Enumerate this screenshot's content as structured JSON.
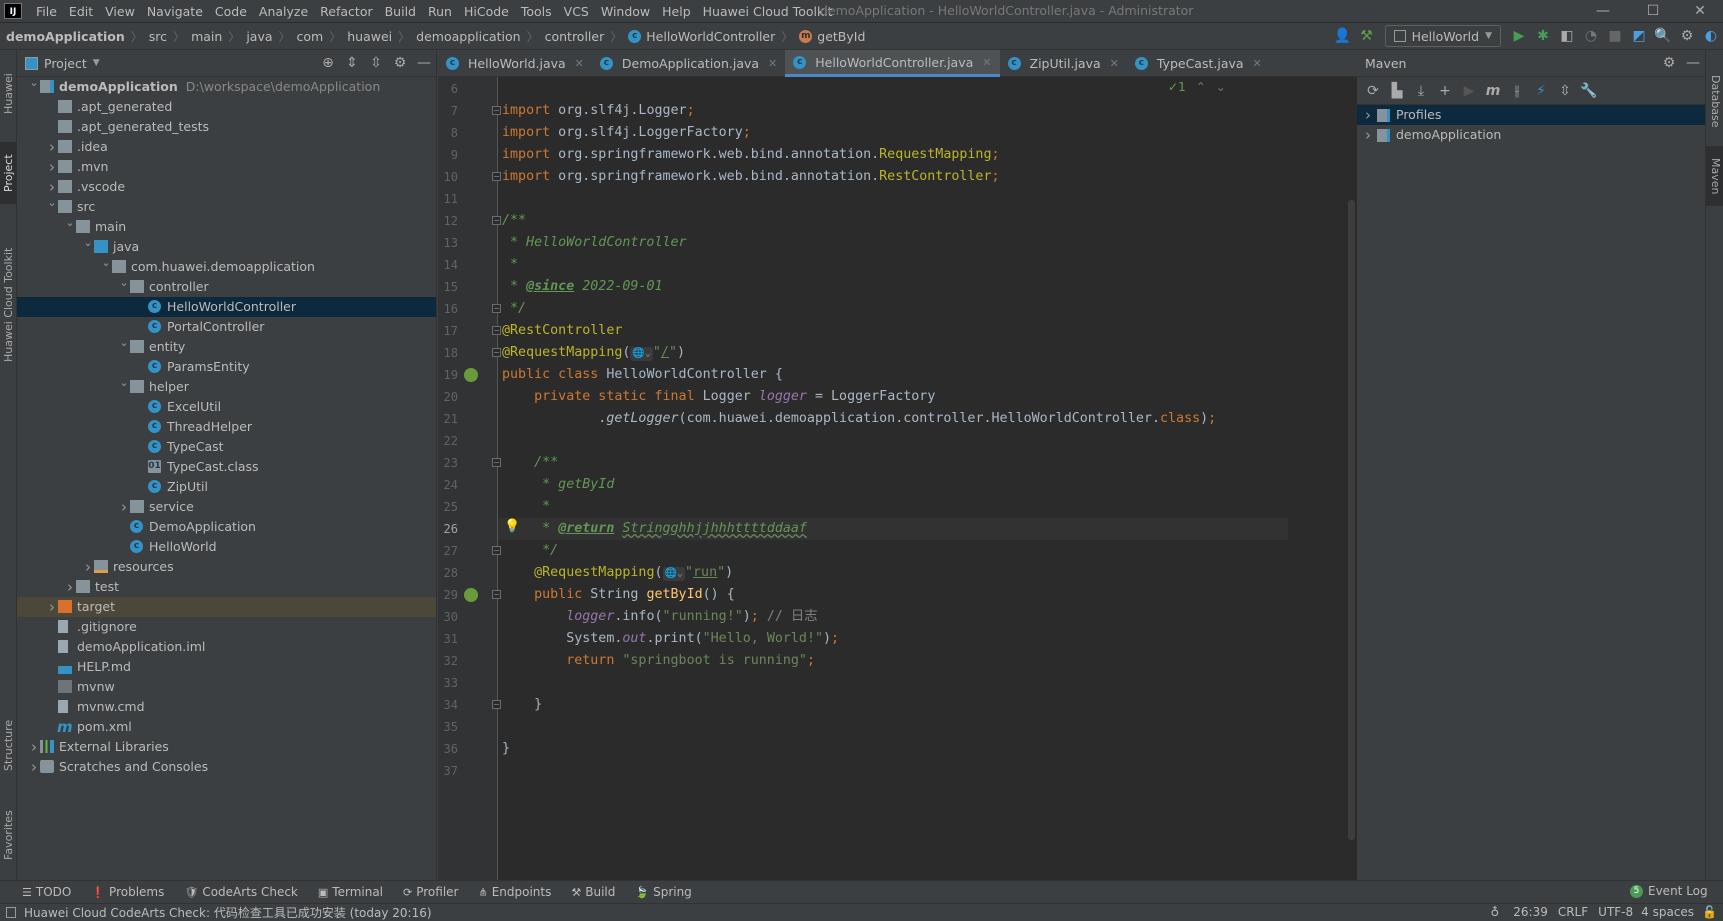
{
  "window": {
    "title": "demoApplication - HelloWorldController.java - Administrator",
    "app_logo": "IJ"
  },
  "menu": [
    "File",
    "Edit",
    "View",
    "Navigate",
    "Code",
    "Analyze",
    "Refactor",
    "Build",
    "Run",
    "HiCode",
    "Tools",
    "VCS",
    "Window",
    "Help",
    "Huawei Cloud Toolkit"
  ],
  "breadcrumb": [
    "demoApplication",
    "src",
    "main",
    "java",
    "com",
    "huawei",
    "demoapplication",
    "controller",
    "HelloWorldController",
    "getById"
  ],
  "toolbar": {
    "run_config": "HelloWorld"
  },
  "left_strip": [
    "Huawei Plugins",
    "Project",
    "Huawei Cloud Toolkit",
    "Structure",
    "Favorites"
  ],
  "right_strip": [
    "Database",
    "Maven"
  ],
  "project": {
    "title": "Project",
    "tree": [
      {
        "label": "demoApplication",
        "level": 0,
        "state": "open",
        "icon": "module",
        "bold": true,
        "extra": "D:\\workspace\\demoApplication"
      },
      {
        "label": ".apt_generated",
        "level": 1,
        "icon": "folder"
      },
      {
        "label": ".apt_generated_tests",
        "level": 1,
        "icon": "folder"
      },
      {
        "label": ".idea",
        "level": 1,
        "state": "closed",
        "icon": "folder"
      },
      {
        "label": ".mvn",
        "level": 1,
        "state": "closed",
        "icon": "folder"
      },
      {
        "label": ".vscode",
        "level": 1,
        "state": "closed",
        "icon": "folder"
      },
      {
        "label": "src",
        "level": 1,
        "state": "open",
        "icon": "folder"
      },
      {
        "label": "main",
        "level": 2,
        "state": "open",
        "icon": "folder"
      },
      {
        "label": "java",
        "level": 3,
        "state": "open",
        "icon": "source-folder"
      },
      {
        "label": "com.huawei.demoapplication",
        "level": 4,
        "state": "open",
        "icon": "package"
      },
      {
        "label": "controller",
        "level": 5,
        "state": "open",
        "icon": "package"
      },
      {
        "label": "HelloWorldController",
        "level": 6,
        "icon": "class",
        "selected": true
      },
      {
        "label": "PortalController",
        "level": 6,
        "icon": "class"
      },
      {
        "label": "entity",
        "level": 5,
        "state": "open",
        "icon": "package"
      },
      {
        "label": "ParamsEntity",
        "level": 6,
        "icon": "class"
      },
      {
        "label": "helper",
        "level": 5,
        "state": "open",
        "icon": "package"
      },
      {
        "label": "ExcelUtil",
        "level": 6,
        "icon": "class"
      },
      {
        "label": "ThreadHelper",
        "level": 6,
        "icon": "class"
      },
      {
        "label": "TypeCast",
        "level": 6,
        "icon": "class"
      },
      {
        "label": "TypeCast.class",
        "level": 6,
        "icon": "class-file"
      },
      {
        "label": "ZipUtil",
        "level": 6,
        "icon": "class"
      },
      {
        "label": "service",
        "level": 5,
        "state": "closed",
        "icon": "package"
      },
      {
        "label": "DemoApplication",
        "level": 5,
        "icon": "spring-class"
      },
      {
        "label": "HelloWorld",
        "level": 5,
        "icon": "runnable-class"
      },
      {
        "label": "resources",
        "level": 3,
        "state": "closed",
        "icon": "resources-folder"
      },
      {
        "label": "test",
        "level": 2,
        "state": "closed",
        "icon": "folder"
      },
      {
        "label": "target",
        "level": 1,
        "state": "closed",
        "icon": "excluded-folder",
        "highlighted": true
      },
      {
        "label": ".gitignore",
        "level": 1,
        "icon": "file"
      },
      {
        "label": "demoApplication.iml",
        "level": 1,
        "icon": "file"
      },
      {
        "label": "HELP.md",
        "level": 1,
        "icon": "markdown"
      },
      {
        "label": "mvnw",
        "level": 1,
        "icon": "shell"
      },
      {
        "label": "mvnw.cmd",
        "level": 1,
        "icon": "text-file"
      },
      {
        "label": "pom.xml",
        "level": 1,
        "icon": "maven"
      },
      {
        "label": "External Libraries",
        "level": 0,
        "state": "closed",
        "icon": "libraries"
      },
      {
        "label": "Scratches and Consoles",
        "level": 0,
        "state": "closed",
        "icon": "scratches"
      }
    ]
  },
  "editor": {
    "tabs": [
      {
        "label": "HelloWorld.java"
      },
      {
        "label": "DemoApplication.java"
      },
      {
        "label": "HelloWorldController.java",
        "active": true
      },
      {
        "label": "ZipUtil.java"
      },
      {
        "label": "TypeCast.java"
      }
    ],
    "inspection_count": "1",
    "current_line": 26,
    "first_line": 6,
    "fold_lines": [
      7,
      10,
      12,
      16,
      17,
      18,
      23,
      27,
      29,
      34
    ],
    "spring_gutter_lines": [
      19,
      29
    ],
    "bulb_line": 26,
    "lines": [
      [],
      [
        [
          "kw",
          "import "
        ],
        [
          "t",
          "org.slf4j.Logger"
        ],
        [
          "semi",
          ";"
        ]
      ],
      [
        [
          "kw",
          "import "
        ],
        [
          "t",
          "org.slf4j.LoggerFactory"
        ],
        [
          "semi",
          ";"
        ]
      ],
      [
        [
          "kw",
          "import "
        ],
        [
          "t",
          "org.springframework.web.bind.annotation."
        ],
        [
          "ann",
          "RequestMapping"
        ],
        [
          "semi",
          ";"
        ]
      ],
      [
        [
          "kw",
          "import "
        ],
        [
          "t",
          "org.springframework.web.bind.annotation."
        ],
        [
          "ann",
          "RestController"
        ],
        [
          "semi",
          ";"
        ]
      ],
      [],
      [
        [
          "doc",
          "/**"
        ]
      ],
      [
        [
          "doc",
          " * HelloWorldController"
        ]
      ],
      [
        [
          "doc",
          " *"
        ]
      ],
      [
        [
          "doc",
          " * "
        ],
        [
          "dtag",
          "@since"
        ],
        [
          "doc",
          " 2022-09-01"
        ]
      ],
      [
        [
          "doc",
          " */"
        ]
      ],
      [
        [
          "ann",
          "@RestController"
        ]
      ],
      [
        [
          "ann",
          "@RequestMapping"
        ],
        [
          "t",
          "("
        ],
        [
          "hint",
          "🌐⌄"
        ],
        [
          "str",
          "\""
        ],
        [
          "ustr",
          "/"
        ],
        [
          "str",
          "\""
        ],
        [
          "t",
          ")"
        ]
      ],
      [
        [
          "kw",
          "public class "
        ],
        [
          "t",
          "HelloWorldController {"
        ]
      ],
      [
        [
          "t",
          "    "
        ],
        [
          "kw",
          "private static final "
        ],
        [
          "t",
          "Logger "
        ],
        [
          "fld",
          "logger"
        ],
        [
          "t",
          " = LoggerFactory"
        ]
      ],
      [
        [
          "t",
          "            ."
        ],
        [
          "ital",
          "getLogger"
        ],
        [
          "t",
          "(com.huawei.demoapplication.controller.HelloWorldController."
        ],
        [
          "kw",
          "class"
        ],
        [
          "t",
          ")"
        ],
        [
          "semi",
          ";"
        ]
      ],
      [],
      [
        [
          "t",
          "    "
        ],
        [
          "doc",
          "/**"
        ]
      ],
      [
        [
          "t",
          "    "
        ],
        [
          "doc",
          " * getById"
        ]
      ],
      [
        [
          "t",
          "    "
        ],
        [
          "doc",
          " *"
        ]
      ],
      [
        [
          "t",
          "    "
        ],
        [
          "doc",
          " * "
        ],
        [
          "dtag",
          "@return"
        ],
        [
          "doc",
          " "
        ],
        [
          "dref",
          "Stringghhjjhhhttttddaaf"
        ]
      ],
      [
        [
          "t",
          "    "
        ],
        [
          "doc",
          " */"
        ]
      ],
      [
        [
          "t",
          "    "
        ],
        [
          "ann",
          "@RequestMapping"
        ],
        [
          "t",
          "("
        ],
        [
          "hint",
          "🌐⌄"
        ],
        [
          "str",
          "\""
        ],
        [
          "ustr",
          "run"
        ],
        [
          "str",
          "\""
        ],
        [
          "t",
          ")"
        ]
      ],
      [
        [
          "t",
          "    "
        ],
        [
          "kw",
          "public "
        ],
        [
          "t",
          "String "
        ],
        [
          "meth",
          "getById"
        ],
        [
          "t",
          "() {"
        ]
      ],
      [
        [
          "t",
          "        "
        ],
        [
          "fld",
          "logger"
        ],
        [
          "t",
          ".info("
        ],
        [
          "str",
          "\"running!\""
        ],
        [
          "t",
          ")"
        ],
        [
          "semi",
          ";"
        ],
        [
          "cmt",
          " // 日志"
        ]
      ],
      [
        [
          "t",
          "        System."
        ],
        [
          "fld",
          "out"
        ],
        [
          "t",
          ".print("
        ],
        [
          "str",
          "\"Hello, World!\""
        ],
        [
          "t",
          ")"
        ],
        [
          "semi",
          ";"
        ]
      ],
      [
        [
          "t",
          "        "
        ],
        [
          "kw",
          "return "
        ],
        [
          "str",
          "\"springboot is running\""
        ],
        [
          "semi",
          ";"
        ]
      ],
      [],
      [
        [
          "t",
          "    }"
        ]
      ],
      [],
      [
        [
          "t",
          "}"
        ]
      ],
      []
    ]
  },
  "maven": {
    "title": "Maven",
    "items": [
      {
        "label": "Profiles",
        "selected": true
      },
      {
        "label": "demoApplication"
      }
    ]
  },
  "bottom_tools": [
    "TODO",
    "Problems",
    "CodeArts Check",
    "Terminal",
    "Profiler",
    "Endpoints",
    "Build",
    "Spring"
  ],
  "event_log": {
    "label": "Event Log",
    "count": "5"
  },
  "status": {
    "message": "Huawei Cloud CodeArts Check: 代码检查工具已成功安装 (today 20:16)",
    "position": "26:39",
    "line_sep": "CRLF",
    "encoding": "UTF-8",
    "indent": "4 spaces"
  },
  "colors": {
    "accent": "#4a88c7",
    "selection": "#0d293e",
    "keyword": "#cc7832",
    "annotation": "#bbb529",
    "string": "#6a8759",
    "doc_comment": "#629755"
  }
}
